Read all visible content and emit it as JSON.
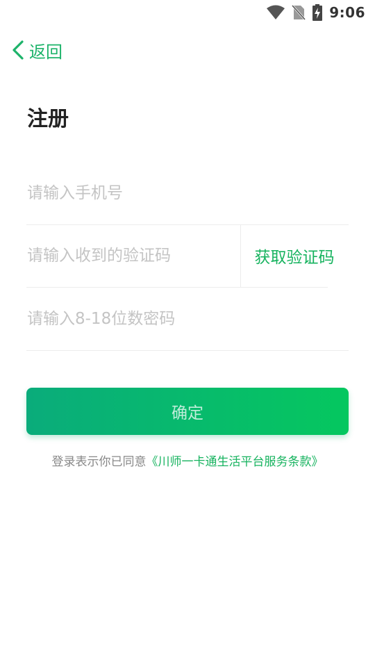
{
  "status_bar": {
    "time": "9:06",
    "icons": [
      "wifi-icon",
      "no-sim-icon",
      "battery-charging-icon"
    ]
  },
  "nav": {
    "back_icon": "chevron-left-icon",
    "back_label": "返回"
  },
  "page": {
    "title": "注册"
  },
  "form": {
    "phone_placeholder": "请输入手机号",
    "phone_value": "",
    "code_placeholder": "请输入收到的验证码",
    "code_value": "",
    "get_code_label": "获取验证码",
    "password_placeholder": "请输入8-18位数密码",
    "password_value": ""
  },
  "actions": {
    "confirm_label": "确定"
  },
  "agreement": {
    "prefix": "登录表示你已同意",
    "link_text": "《川师一卡通生活平台服务条款》"
  },
  "colors": {
    "accent": "#17b35f",
    "button_gradient_start": "#0aac7b",
    "button_gradient_end": "#05c75f",
    "placeholder": "#c4c4c4"
  }
}
